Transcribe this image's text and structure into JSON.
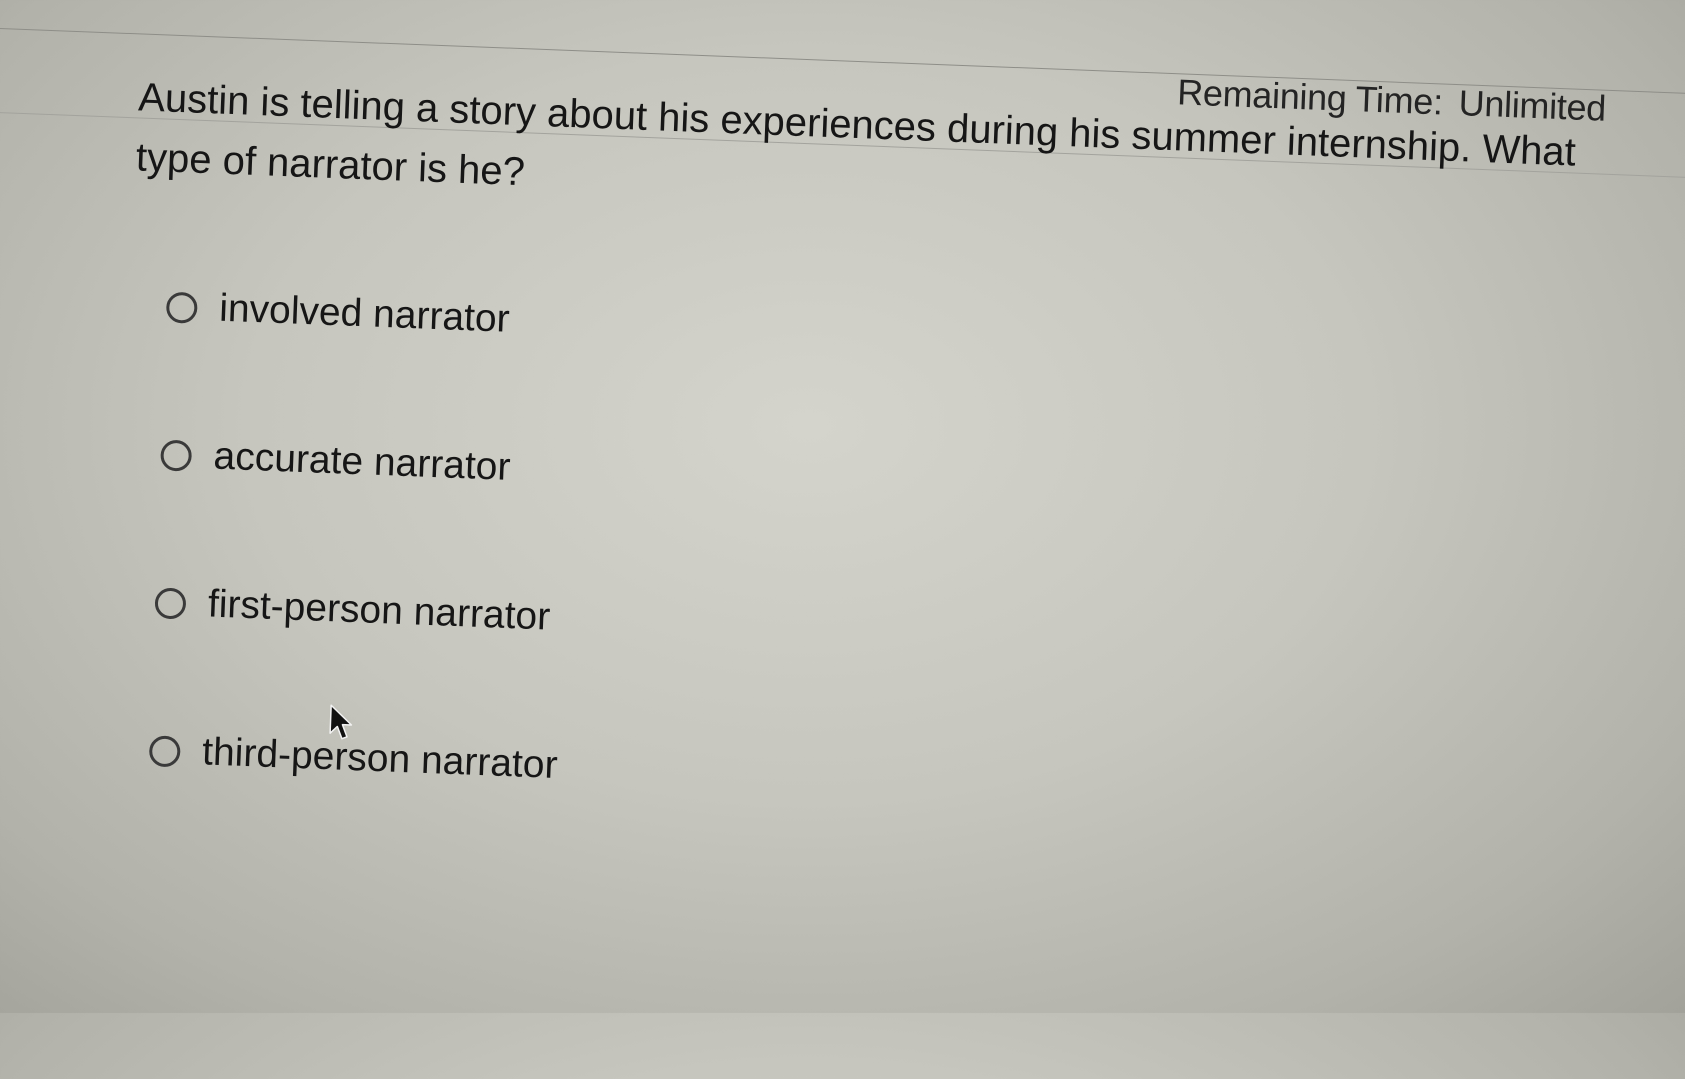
{
  "header": {
    "timer_label": "Remaining Time:",
    "timer_value": "Unlimited"
  },
  "question": {
    "text": "Austin is telling a story about his experiences during his summer internship. What type of narrator is he?"
  },
  "options": [
    {
      "label": "involved narrator",
      "selected": false
    },
    {
      "label": "accurate narrator",
      "selected": false
    },
    {
      "label": "first-person narrator",
      "selected": false
    },
    {
      "label": "third-person narrator",
      "selected": false
    }
  ],
  "icons": {
    "cursor": "mouse-pointer-arrow"
  }
}
